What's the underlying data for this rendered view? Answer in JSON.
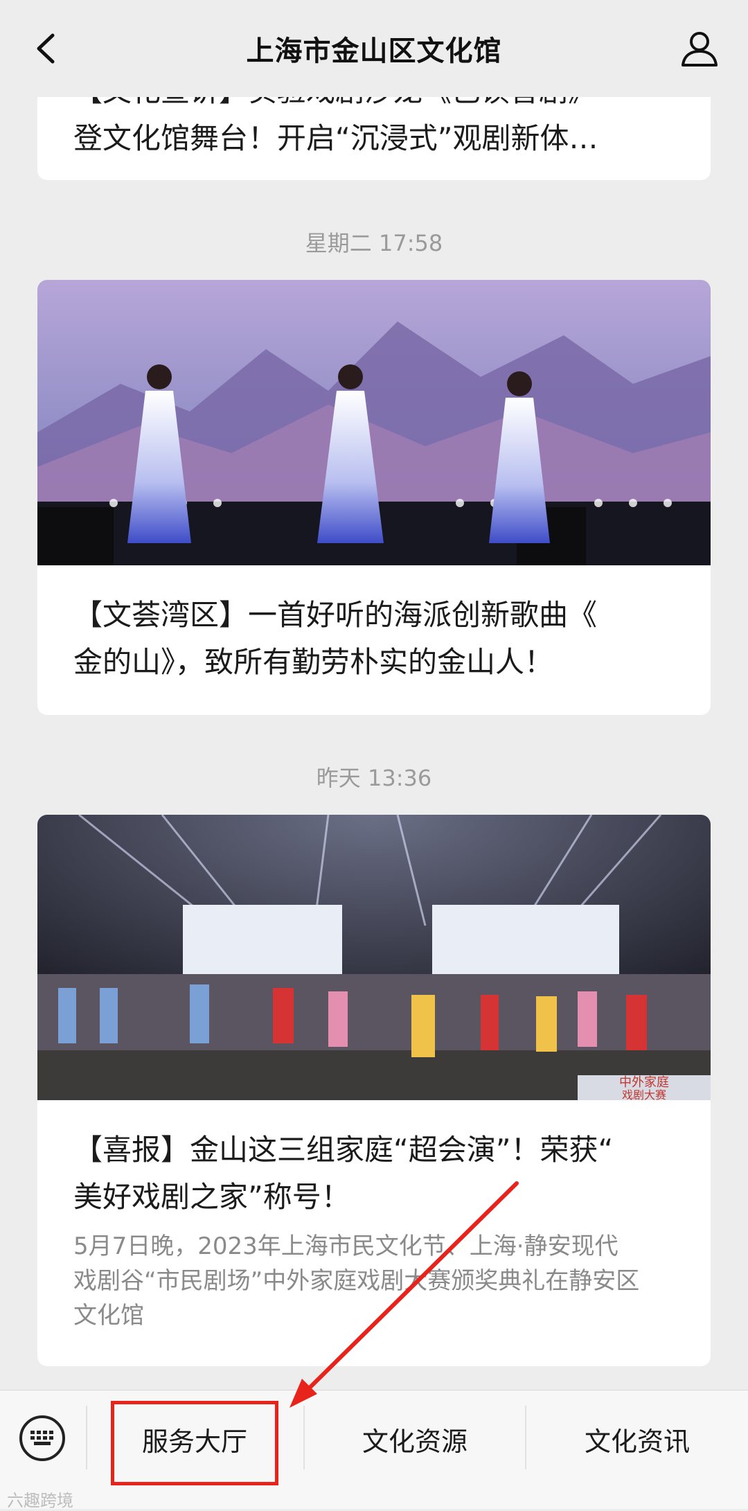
{
  "header": {
    "title": "上海市金山区文化馆"
  },
  "top_card": {
    "title_line1": "【文化宣讲】实验戏剧沙龙《已读普剧》",
    "title_line2": "登文化馆舞台！开启“沉浸式”观剧新体…"
  },
  "articles": [
    {
      "timestamp": "星期二 17:58",
      "title_line1": "【文荟湾区】一首好听的海派创新歌曲《",
      "title_line2": "金的山》，致所有勤劳朴实的金山人！"
    },
    {
      "timestamp": "昨天 13:36",
      "image_caption_line1": "中外家庭",
      "image_caption_line2": "戏剧大赛",
      "title_line1": "【喜报】金山这三组家庭“超会演”！荣获“",
      "title_line2": "美好戏剧之家”称号！",
      "summary_line1": "5月7日晚，2023年上海市民文化节、上海·静安现代",
      "summary_line2": "戏剧谷“市民剧场”中外家庭戏剧大赛颁奖典礼在静安区",
      "summary_line3": "文化馆"
    }
  ],
  "bottom_menu": [
    {
      "label": "服务大厅"
    },
    {
      "label": "文化资源"
    },
    {
      "label": "文化资讯"
    }
  ],
  "watermark": "六趣跨境",
  "colors": {
    "highlight": "#e8231c",
    "background": "#ededed"
  }
}
